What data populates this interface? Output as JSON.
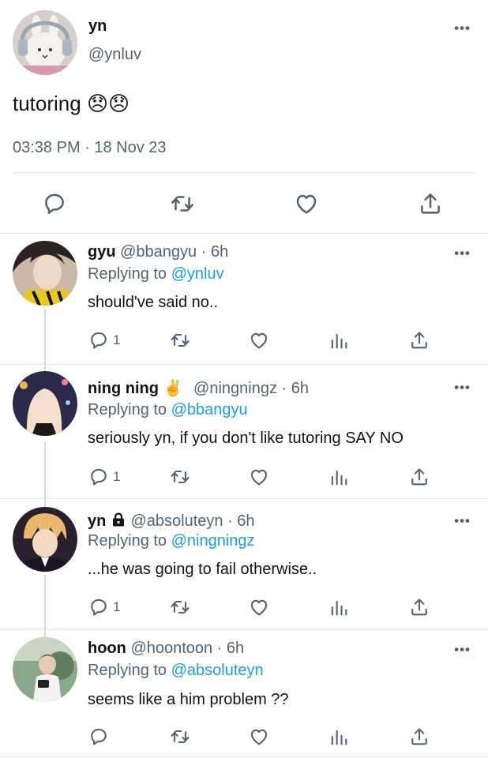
{
  "main_tweet": {
    "name": "yn",
    "handle": "@ynluv",
    "text": "tutoring 😞😞",
    "timestamp": "03:38 PM · 18 Nov 23",
    "more": "•••",
    "actions": [
      "reply-icon",
      "retweet-icon",
      "like-icon",
      "share-icon"
    ]
  },
  "replies": [
    {
      "name": "gyu",
      "badge": "",
      "handle": "@bbangyu · 6h",
      "replying_label": "Replying to",
      "replying_to": "@ynluv",
      "text": "should've said no..",
      "reply_count": "1",
      "more": "•••"
    },
    {
      "name": "ning ning",
      "badge": "✌️",
      "handle": "@ningningz · 6h",
      "replying_label": "Replying to",
      "replying_to": "@bbangyu",
      "text": "seriously yn, if you don't like tutoring SAY NO",
      "reply_count": "1",
      "more": "•••"
    },
    {
      "name": "yn",
      "badge": "lock-icon",
      "handle": "@absoluteyn · 6h",
      "replying_label": "Replying to",
      "replying_to": "@ningningz",
      "text": "...he was going to fail otherwise..",
      "reply_count": "1",
      "more": "•••"
    },
    {
      "name": "hoon",
      "badge": "",
      "handle": "@hoontoon · 6h",
      "replying_label": "Replying to",
      "replying_to": "@absoluteyn",
      "text": "seems like a him problem ??",
      "reply_count": "",
      "more": "•••"
    }
  ],
  "colors": {
    "text": "#0f1419",
    "secondary": "#536471",
    "link": "#1d9bf0",
    "divider": "#e3e6e8"
  }
}
